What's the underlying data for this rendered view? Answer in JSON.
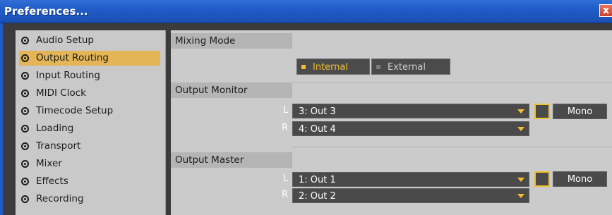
{
  "window": {
    "title": "Preferences...",
    "close_glyph": "x"
  },
  "sidebar": {
    "items": [
      {
        "label": "Audio Setup",
        "active": false
      },
      {
        "label": "Output Routing",
        "active": true
      },
      {
        "label": "Input Routing",
        "active": false
      },
      {
        "label": "MIDI Clock",
        "active": false
      },
      {
        "label": "Timecode Setup",
        "active": false
      },
      {
        "label": "Loading",
        "active": false
      },
      {
        "label": "Transport",
        "active": false
      },
      {
        "label": "Mixer",
        "active": false
      },
      {
        "label": "Effects",
        "active": false
      },
      {
        "label": "Recording",
        "active": false
      }
    ]
  },
  "mixing_mode": {
    "header": "Mixing Mode",
    "options": {
      "internal": "Internal",
      "external": "External"
    },
    "selected": "Internal"
  },
  "output_monitor": {
    "header": "Output Monitor",
    "left_label": "L",
    "right_label": "R",
    "left_value": "3: Out 3",
    "right_value": "4: Out 4",
    "mono_label": "Mono"
  },
  "output_master": {
    "header": "Output Master",
    "left_label": "L",
    "right_label": "R",
    "left_value": "1: Out 1",
    "right_value": "2: Out 2",
    "mono_label": "Mono"
  },
  "colors": {
    "accent": "#f2c02c",
    "active_item": "#e3b556",
    "titlebar": "#1f5bc6"
  }
}
